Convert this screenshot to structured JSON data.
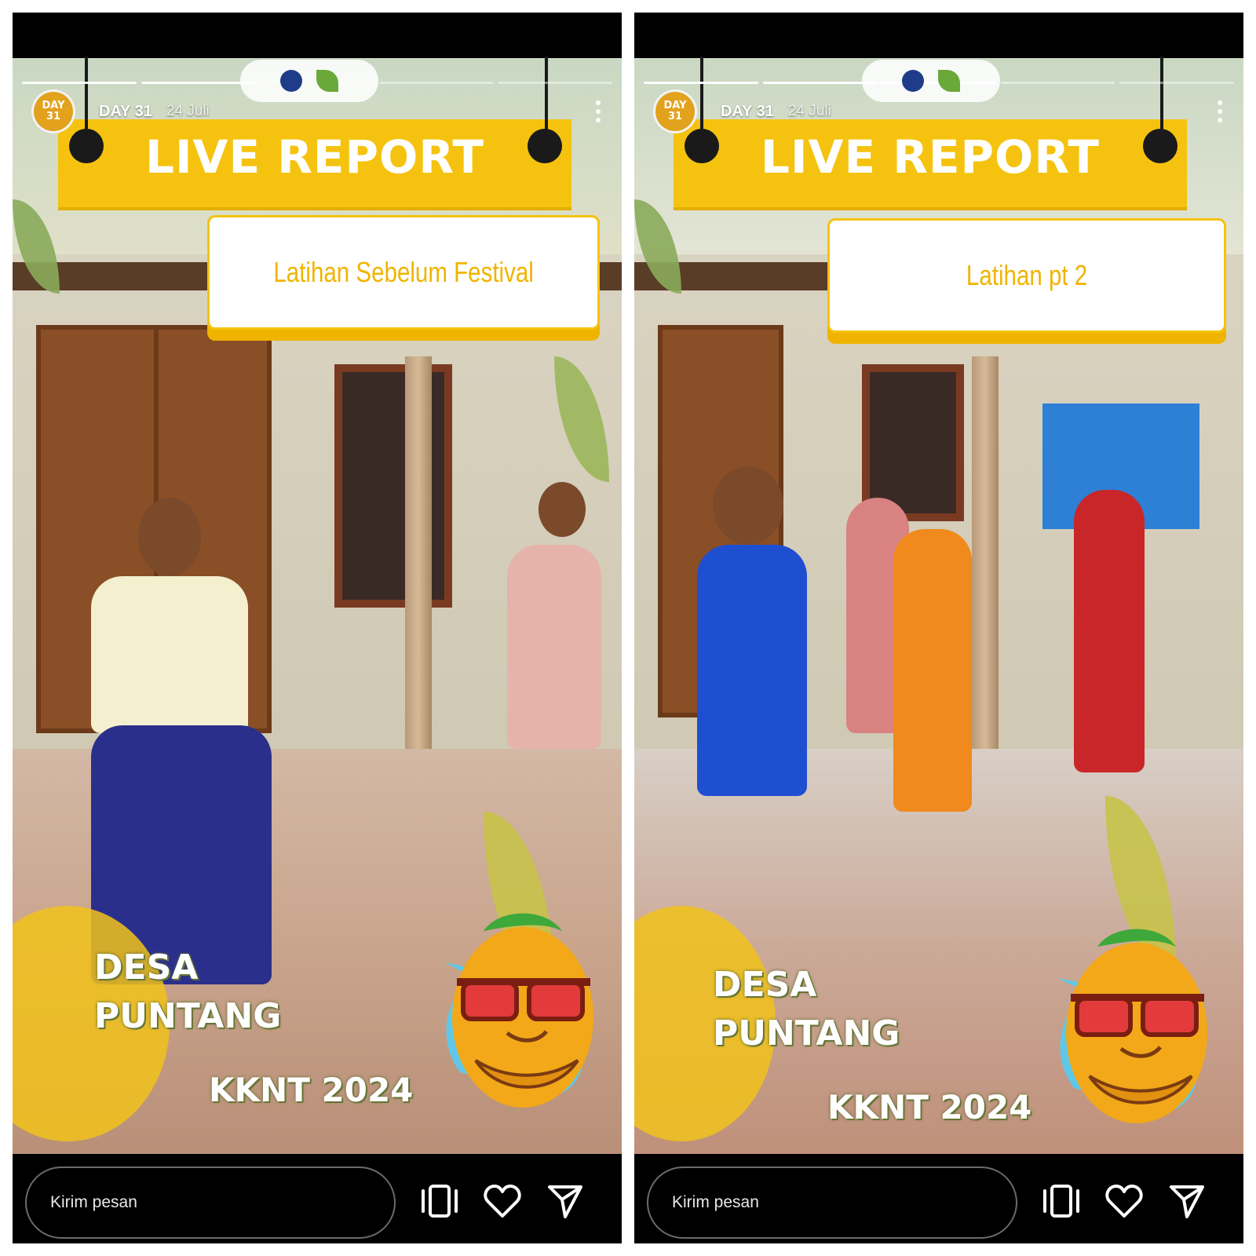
{
  "stories": [
    {
      "username": "DAY 31",
      "date": "24 Juli",
      "avatar_text": [
        "DAY",
        "31"
      ],
      "progress": {
        "total": 5,
        "current": 2
      },
      "banner_title": "LIVE REPORT",
      "subtitle": "Latihan Sebelum Festival",
      "location_line1": "DESA",
      "location_line2": "PUNTANG",
      "footer_tag": "KKNT 2024",
      "message_placeholder": "Kirim pesan",
      "icons": [
        "more-vertical-icon",
        "carousel-icon",
        "heart-icon",
        "send-icon"
      ]
    },
    {
      "username": "DAY 31",
      "date": "24 Juli",
      "avatar_text": [
        "DAY",
        "31"
      ],
      "progress": {
        "total": 5,
        "current": 3
      },
      "banner_title": "LIVE REPORT",
      "subtitle": "Latihan pt 2",
      "location_line1": "DESA",
      "location_line2": "PUNTANG",
      "footer_tag": "KKNT 2024",
      "message_placeholder": "Kirim pesan",
      "icons": [
        "more-vertical-icon",
        "carousel-icon",
        "heart-icon",
        "send-icon"
      ]
    }
  ],
  "colors": {
    "accent_yellow": "#f5c30f",
    "subtitle_yellow": "#f0b400",
    "background": "#000000"
  }
}
